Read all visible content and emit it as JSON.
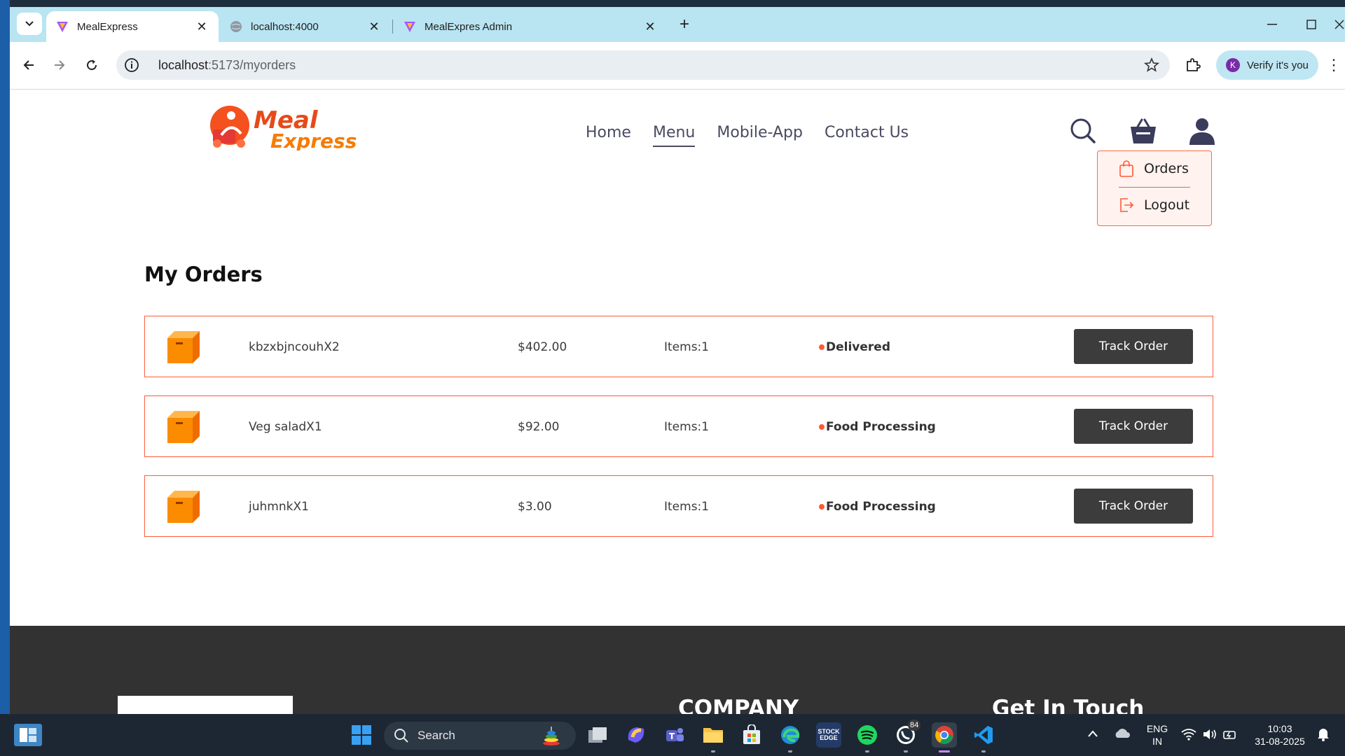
{
  "browser": {
    "tabs": [
      {
        "title": "MealExpress",
        "active": true
      },
      {
        "title": "localhost:4000",
        "active": false
      },
      {
        "title": "MealExpres Admin",
        "active": false
      }
    ],
    "url_host": "localhost",
    "url_path": ":5173/myorders",
    "verify_label": "Verify it's you",
    "profile_initial": "K"
  },
  "header": {
    "logo_text_1": "Meal",
    "logo_text_2": "Express",
    "nav": [
      "Home",
      "Menu",
      "Mobile-App",
      "Contact Us"
    ],
    "active_nav": "Menu"
  },
  "dropdown": {
    "items": [
      "Orders",
      "Logout"
    ]
  },
  "main": {
    "title": "My Orders",
    "orders": [
      {
        "items_text": "kbzxbjncouhX2",
        "amount": "$402.00",
        "count": "Items:1",
        "status": "Delivered",
        "action": "Track Order"
      },
      {
        "items_text": "Veg saladX1",
        "amount": "$92.00",
        "count": "Items:1",
        "status": "Food Processing",
        "action": "Track Order"
      },
      {
        "items_text": "juhmnkX1",
        "amount": "$3.00",
        "count": "Items:1",
        "status": "Food Processing",
        "action": "Track Order"
      }
    ]
  },
  "footer": {
    "company_title": "COMPANY",
    "contact_title": "Get In Touch"
  },
  "taskbar": {
    "search_label": "Search",
    "whatsapp_badge": "84",
    "lang_1": "ENG",
    "lang_2": "IN",
    "time": "10:03",
    "date": "31-08-2025",
    "stocks_label": "STOCK EDGE"
  },
  "colors": {
    "accent": "#ff5a36",
    "button": "#3c3c3c",
    "tabstrip": "#b9e4f1",
    "footer": "#323232"
  }
}
